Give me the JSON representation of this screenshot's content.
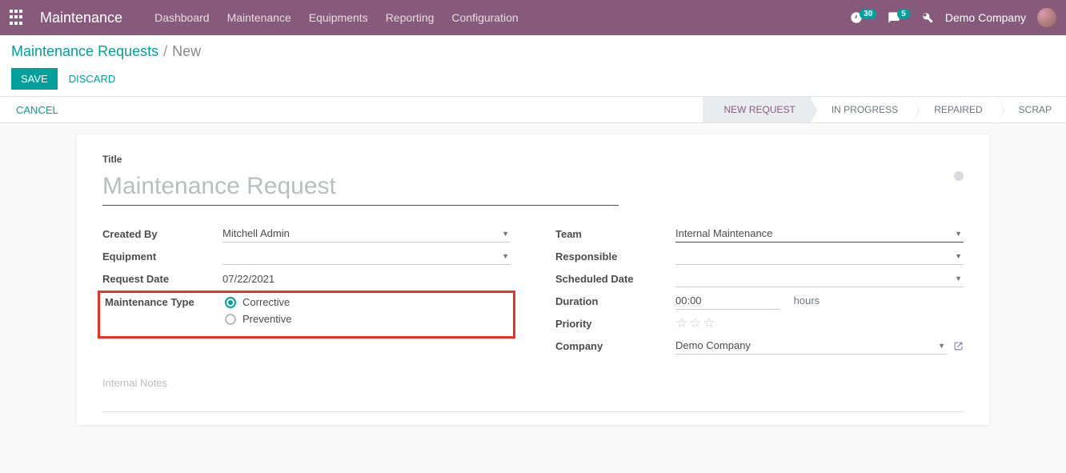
{
  "header": {
    "brand": "Maintenance",
    "nav": [
      "Dashboard",
      "Maintenance",
      "Equipments",
      "Reporting",
      "Configuration"
    ],
    "activities_badge": "30",
    "messages_badge": "5",
    "company": "Demo Company"
  },
  "breadcrumb": {
    "parent": "Maintenance Requests",
    "current": "New"
  },
  "buttons": {
    "save": "SAVE",
    "discard": "DISCARD",
    "cancel": "CANCEL"
  },
  "status": {
    "items": [
      "NEW REQUEST",
      "IN PROGRESS",
      "REPAIRED",
      "SCRAP"
    ],
    "active": 0
  },
  "form": {
    "title_label": "Title",
    "title_placeholder": "Maintenance Request",
    "left": {
      "created_by_label": "Created By",
      "created_by_value": "Mitchell Admin",
      "equipment_label": "Equipment",
      "equipment_value": "",
      "request_date_label": "Request Date",
      "request_date_value": "07/22/2021",
      "maint_type_label": "Maintenance Type",
      "radio_corrective": "Corrective",
      "radio_preventive": "Preventive"
    },
    "right": {
      "team_label": "Team",
      "team_value": "Internal Maintenance",
      "responsible_label": "Responsible",
      "responsible_value": "",
      "scheduled_date_label": "Scheduled Date",
      "scheduled_date_value": "",
      "duration_label": "Duration",
      "duration_value": "00:00",
      "duration_unit": "hours",
      "priority_label": "Priority",
      "company_label": "Company",
      "company_value": "Demo Company"
    },
    "notes_placeholder": "Internal Notes"
  }
}
